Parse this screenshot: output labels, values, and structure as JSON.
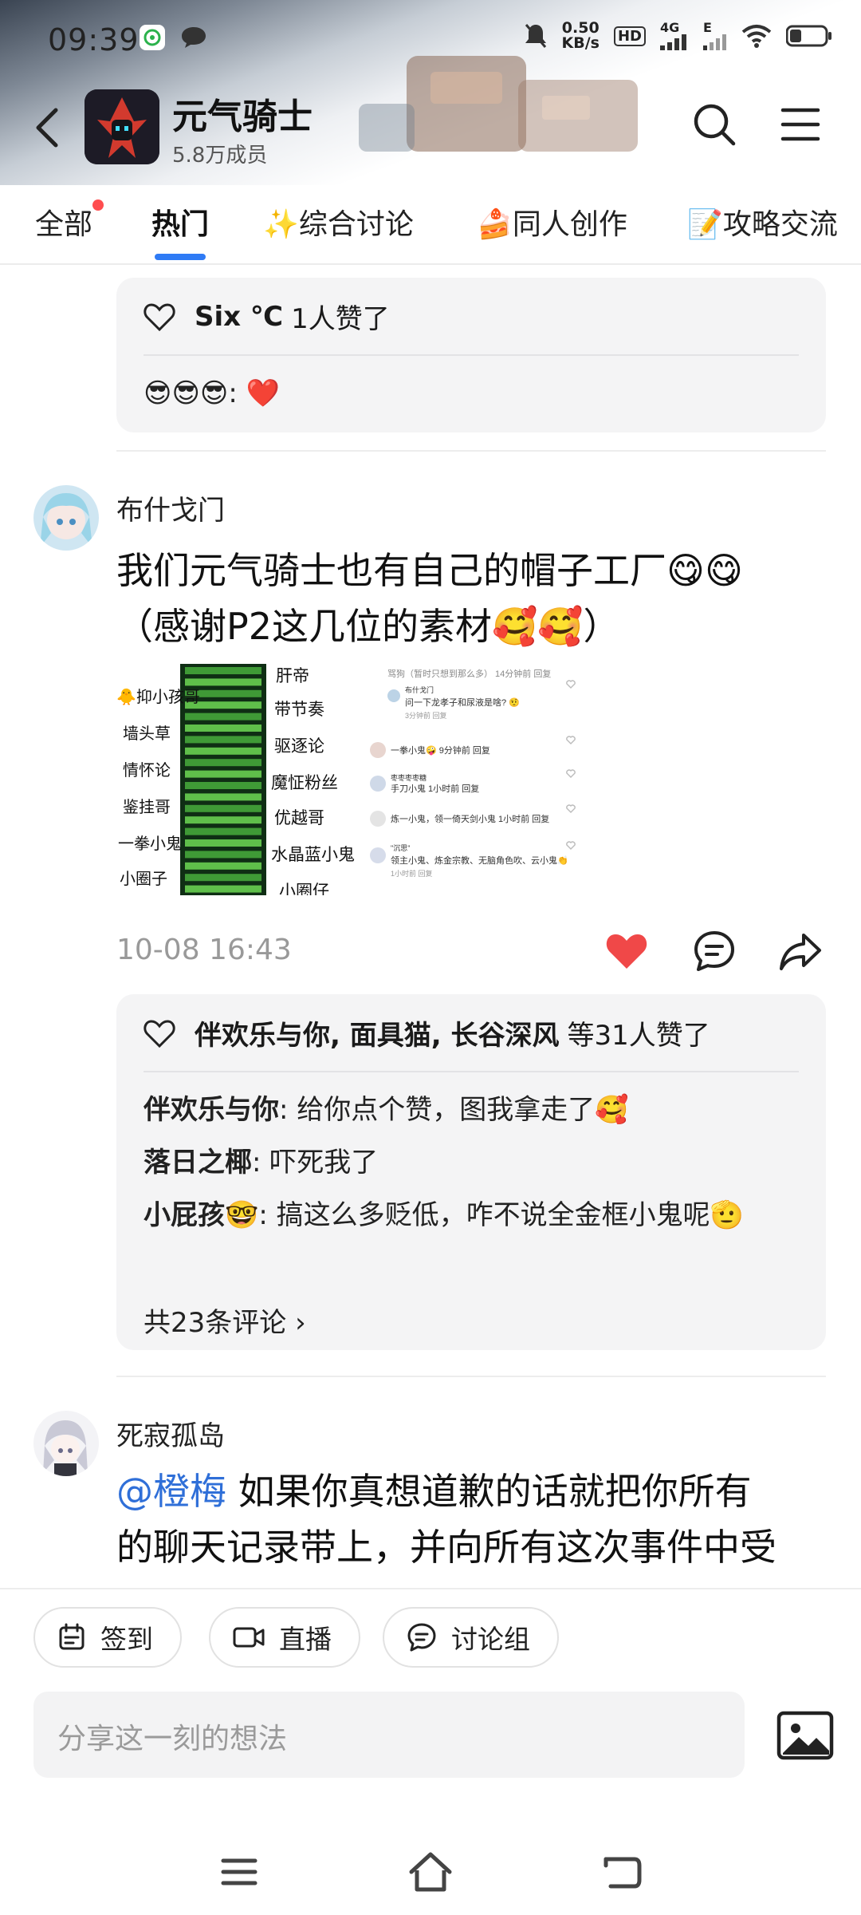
{
  "status_bar": {
    "time": "09:39",
    "net_speed_value": "0.50",
    "net_speed_unit": "KB/s",
    "hd_label": "HD",
    "cell_label": "4G",
    "cell2_label": "E"
  },
  "group": {
    "name": "元气骑士",
    "members": "5.8万成员"
  },
  "tabs": [
    {
      "label": "全部"
    },
    {
      "label": "热门"
    },
    {
      "label": "✨综合讨论"
    },
    {
      "label": "🍰同人创作"
    },
    {
      "label": "📝攻略交流"
    }
  ],
  "post0": {
    "likes_names": "Six ℃",
    "likes_suffix": "1人赞了",
    "comment": "😎😎😎: ❤️"
  },
  "post1": {
    "author": "布什戈门",
    "text_line1": "我们元气骑士也有自己的帽子工厂😋😋",
    "text_line2": "（感谢P2这几位的素材🥰🥰）",
    "image": {
      "left_labels": [
        "🐥抑小孩哥",
        "墙头草",
        "情怀论",
        "鉴挂哥",
        "一拳小鬼",
        "小圈子"
      ],
      "right_labels": [
        "肝帝",
        "带节奏",
        "驱逐论",
        "魔怔粉丝",
        "优越哥",
        "水晶蓝小鬼",
        "小圈仔"
      ],
      "thread_header": "骂狗（暂时只想到那么多） 14分钟前 回复",
      "thread": [
        {
          "name": "布什戈门",
          "text": "问一下龙孝子和尿液是啥? 🤨",
          "meta": "3分钟前 回复"
        },
        {
          "name": "",
          "text": "一拳小鬼🤪 9分钟前 回复",
          "meta": ""
        },
        {
          "name": "枣枣枣枣糖",
          "text": "手刀小鬼 1小时前 回复",
          "meta": ""
        },
        {
          "name": "",
          "text": "炼一小鬼，领一倚天剑小鬼 1小时前 回复",
          "meta": ""
        },
        {
          "name": "\"沉思\"",
          "text": "领主小鬼、炼金宗教、无脑角色吹、云小鬼👏",
          "meta": "1小时前 回复"
        }
      ]
    },
    "timestamp": "10-08 16:43",
    "likes_names": "伴欢乐与你, 面具猫, 长谷深风",
    "likes_suffix": "等31人赞了",
    "comments": [
      {
        "name": "伴欢乐与你",
        "text": ": 给你点个赞，图我拿走了🥰"
      },
      {
        "name": "落日之椰",
        "text": ": 吓死我了"
      },
      {
        "name": "小屁孩🤓",
        "text": ": 搞这么多贬低，咋不说全金框小鬼呢🫡"
      }
    ],
    "more_comments": "共23条评论 ›"
  },
  "post2": {
    "author": "死寂孤岛",
    "mention": "@橙梅",
    "text_line1": "  如果你真想道歉的话就把你所有",
    "text_line2": "的聊天记录带上，并向所有这次事件中受"
  },
  "chips": [
    {
      "label": "签到",
      "icon": "calendar-icon"
    },
    {
      "label": "直播",
      "icon": "video-icon"
    },
    {
      "label": "讨论组",
      "icon": "chat-bubble-icon"
    }
  ],
  "composer": {
    "placeholder": "分享这一刻的想法"
  },
  "colors": {
    "accent": "#2f7bf5",
    "like_red": "#f04848",
    "mention_blue": "#2f6fd8",
    "badge_red": "#ff4d4f"
  }
}
